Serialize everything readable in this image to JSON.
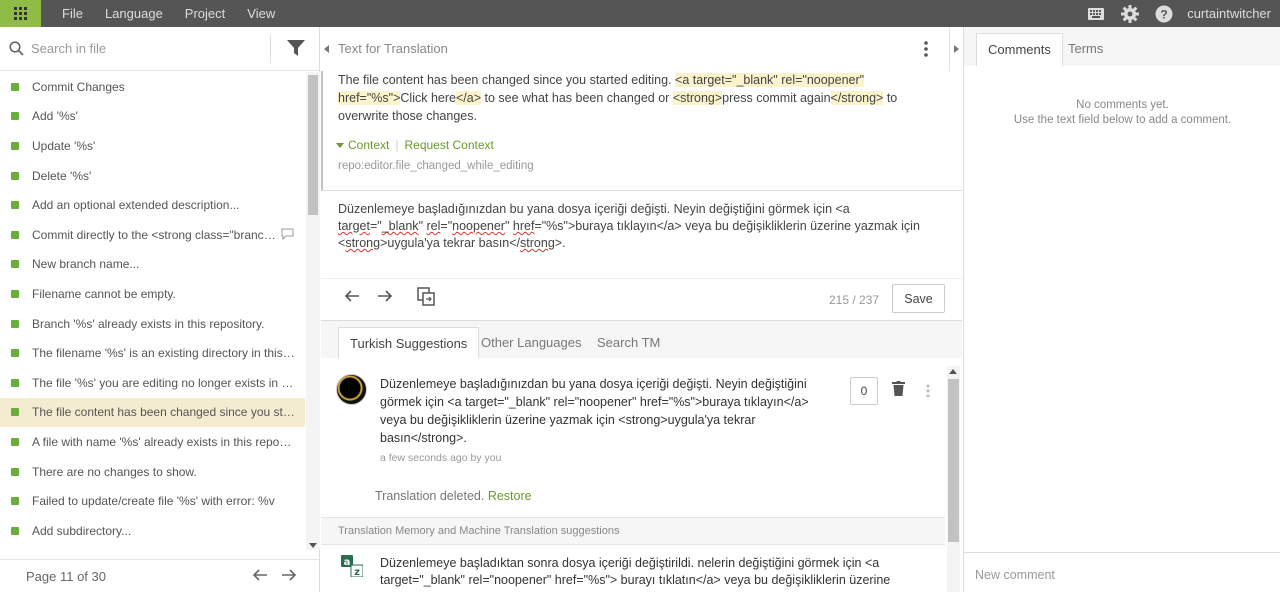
{
  "menu": [
    "File",
    "Language",
    "Project",
    "View"
  ],
  "user": {
    "name": "curtaintwitcher"
  },
  "search": {
    "placeholder": "Search in file"
  },
  "strings": [
    {
      "text": "Commit Changes"
    },
    {
      "text": "Add '%s'"
    },
    {
      "text": "Update '%s'"
    },
    {
      "text": "Delete '%s'"
    },
    {
      "text": "Add an optional extended description..."
    },
    {
      "text": "Commit directly to the <strong class=\"branch-name\">",
      "has_comment": true
    },
    {
      "text": "New branch name..."
    },
    {
      "text": "Filename cannot be empty."
    },
    {
      "text": "Branch '%s' already exists in this repository."
    },
    {
      "text": "The filename '%s' is an existing directory in this repository."
    },
    {
      "text": "The file '%s' you are editing no longer exists in this repository."
    },
    {
      "text": "The file content has been changed since you started editing.",
      "active": true
    },
    {
      "text": "A file with name '%s' already exists in this repository."
    },
    {
      "text": "There are no changes to show."
    },
    {
      "text": "Failed to update/create file '%s' with error: %v"
    },
    {
      "text": "Add subdirectory..."
    }
  ],
  "pager": {
    "label": "Page 11 of 30"
  },
  "source": {
    "header": "Text for Translation",
    "segments": [
      {
        "t": "The file content has been changed since you started editing. ",
        "hl": false
      },
      {
        "t": "<a target=\"_blank\" rel=\"noopener\" href=\"%s\">",
        "hl": true
      },
      {
        "t": "Click here",
        "hl": false
      },
      {
        "t": "</a>",
        "hl": true
      },
      {
        "t": " to see what has been changed or ",
        "hl": false
      },
      {
        "t": "<strong>",
        "hl": true
      },
      {
        "t": "press commit again",
        "hl": false
      },
      {
        "t": "</strong>",
        "hl": true
      },
      {
        "t": " to overwrite those changes.",
        "hl": false
      }
    ],
    "context_label": "Context",
    "request_context_label": "Request Context",
    "key": "repo:editor.file_changed_while_editing"
  },
  "translation": {
    "segments": [
      {
        "t": "Düzenlemeye başladığınızdan bu yana dosya içeriği değişti. Neyin değiştiğini görmek için <a ",
        "w": false
      },
      {
        "t": "target",
        "w": true
      },
      {
        "t": "=\"",
        "w": false
      },
      {
        "t": "_blank",
        "w": true
      },
      {
        "t": "\" ",
        "w": false
      },
      {
        "t": "rel",
        "w": true
      },
      {
        "t": "=\"",
        "w": false
      },
      {
        "t": "noopener",
        "w": true
      },
      {
        "t": "\" ",
        "w": false
      },
      {
        "t": "href",
        "w": true
      },
      {
        "t": "=\"%s\">buraya tıklayın</a> veya bu değişikliklerin üzerine yazmak için <",
        "w": false
      },
      {
        "t": "strong",
        "w": true
      },
      {
        "t": ">uygula'ya tekrar basın</",
        "w": false
      },
      {
        "t": "strong",
        "w": true
      },
      {
        "t": ">.",
        "w": false
      }
    ]
  },
  "toolbar": {
    "counter": "215 / 237",
    "save_label": "Save"
  },
  "suggestion_tabs": [
    "Turkish Suggestions",
    "Other Languages",
    "Search TM"
  ],
  "suggestion": {
    "text": "Düzenlemeye başladığınızdan bu yana dosya içeriği değişti. Neyin değiştiğini görmek için <a target=\"_blank\" rel=\"noopener\" href=\"%s\">buraya tıklayın</a> veya bu değişikliklerin üzerine yazmak için <strong>uygula'ya tekrar basın</strong>.",
    "meta": "a few seconds ago by you",
    "votes": "0",
    "deleted_text": "Translation deleted.",
    "restore_label": "Restore"
  },
  "tm": {
    "header": "Translation Memory and Machine Translation suggestions",
    "text": "Düzenlemeye başladıktan sonra dosya içeriği değiştirildi. nelerin değiştiğini görmek için <a target=\"_blank\" rel=\"noopener\" href=\"%s\"> burayı tıklatın</a> veya bu değişikliklerin üzerine"
  },
  "right_tabs": [
    "Comments",
    "Terms"
  ],
  "comments": {
    "empty_line1": "No comments yet.",
    "empty_line2": "Use the text field below to add a comment.",
    "placeholder": "New comment"
  },
  "colors": {
    "brand": "#8fbc45",
    "accent": "#6a9a2a",
    "active_row": "#f3ecd1",
    "topbar": "#555555"
  }
}
